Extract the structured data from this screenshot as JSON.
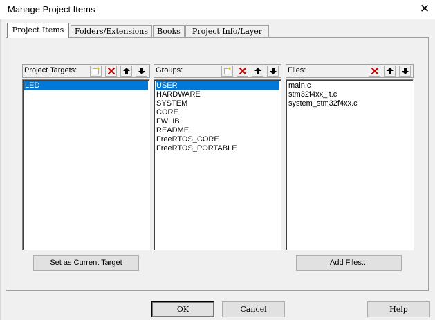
{
  "window": {
    "title": "Manage Project Items",
    "close_glyph": "✕"
  },
  "tabs": [
    {
      "label": "Project Items",
      "active": true
    },
    {
      "label": "Folders/Extensions",
      "active": false
    },
    {
      "label": "Books",
      "active": false
    },
    {
      "label": "Project Info/Layer",
      "active": false
    }
  ],
  "targets": {
    "label": "Project Targets:",
    "items": [
      "LED"
    ],
    "selected": "LED"
  },
  "groups": {
    "label": "Groups:",
    "items": [
      "USER",
      "HARDWARE",
      "SYSTEM",
      "CORE",
      "FWLIB",
      "README",
      "FreeRTOS_CORE",
      "FreeRTOS_PORTABLE"
    ],
    "selected": "USER"
  },
  "files": {
    "label": "Files:",
    "items": [
      "main.c",
      "stm32f4xx_it.c",
      "system_stm32f4xx.c"
    ]
  },
  "buttons": {
    "set_target_mnemonic": "S",
    "set_target_rest": "et as Current Target",
    "add_files_mnemonic": "A",
    "add_files_rest": "dd Files...",
    "ok": "OK",
    "cancel": "Cancel",
    "help": "Help"
  },
  "icons": {
    "new": "new-item-icon",
    "delete": "delete-icon",
    "up": "move-up-icon",
    "down": "move-down-icon"
  },
  "colors": {
    "selection": "#0078d7",
    "delete_red": "#c00000",
    "dialog_bg": "#f0f0f0"
  }
}
